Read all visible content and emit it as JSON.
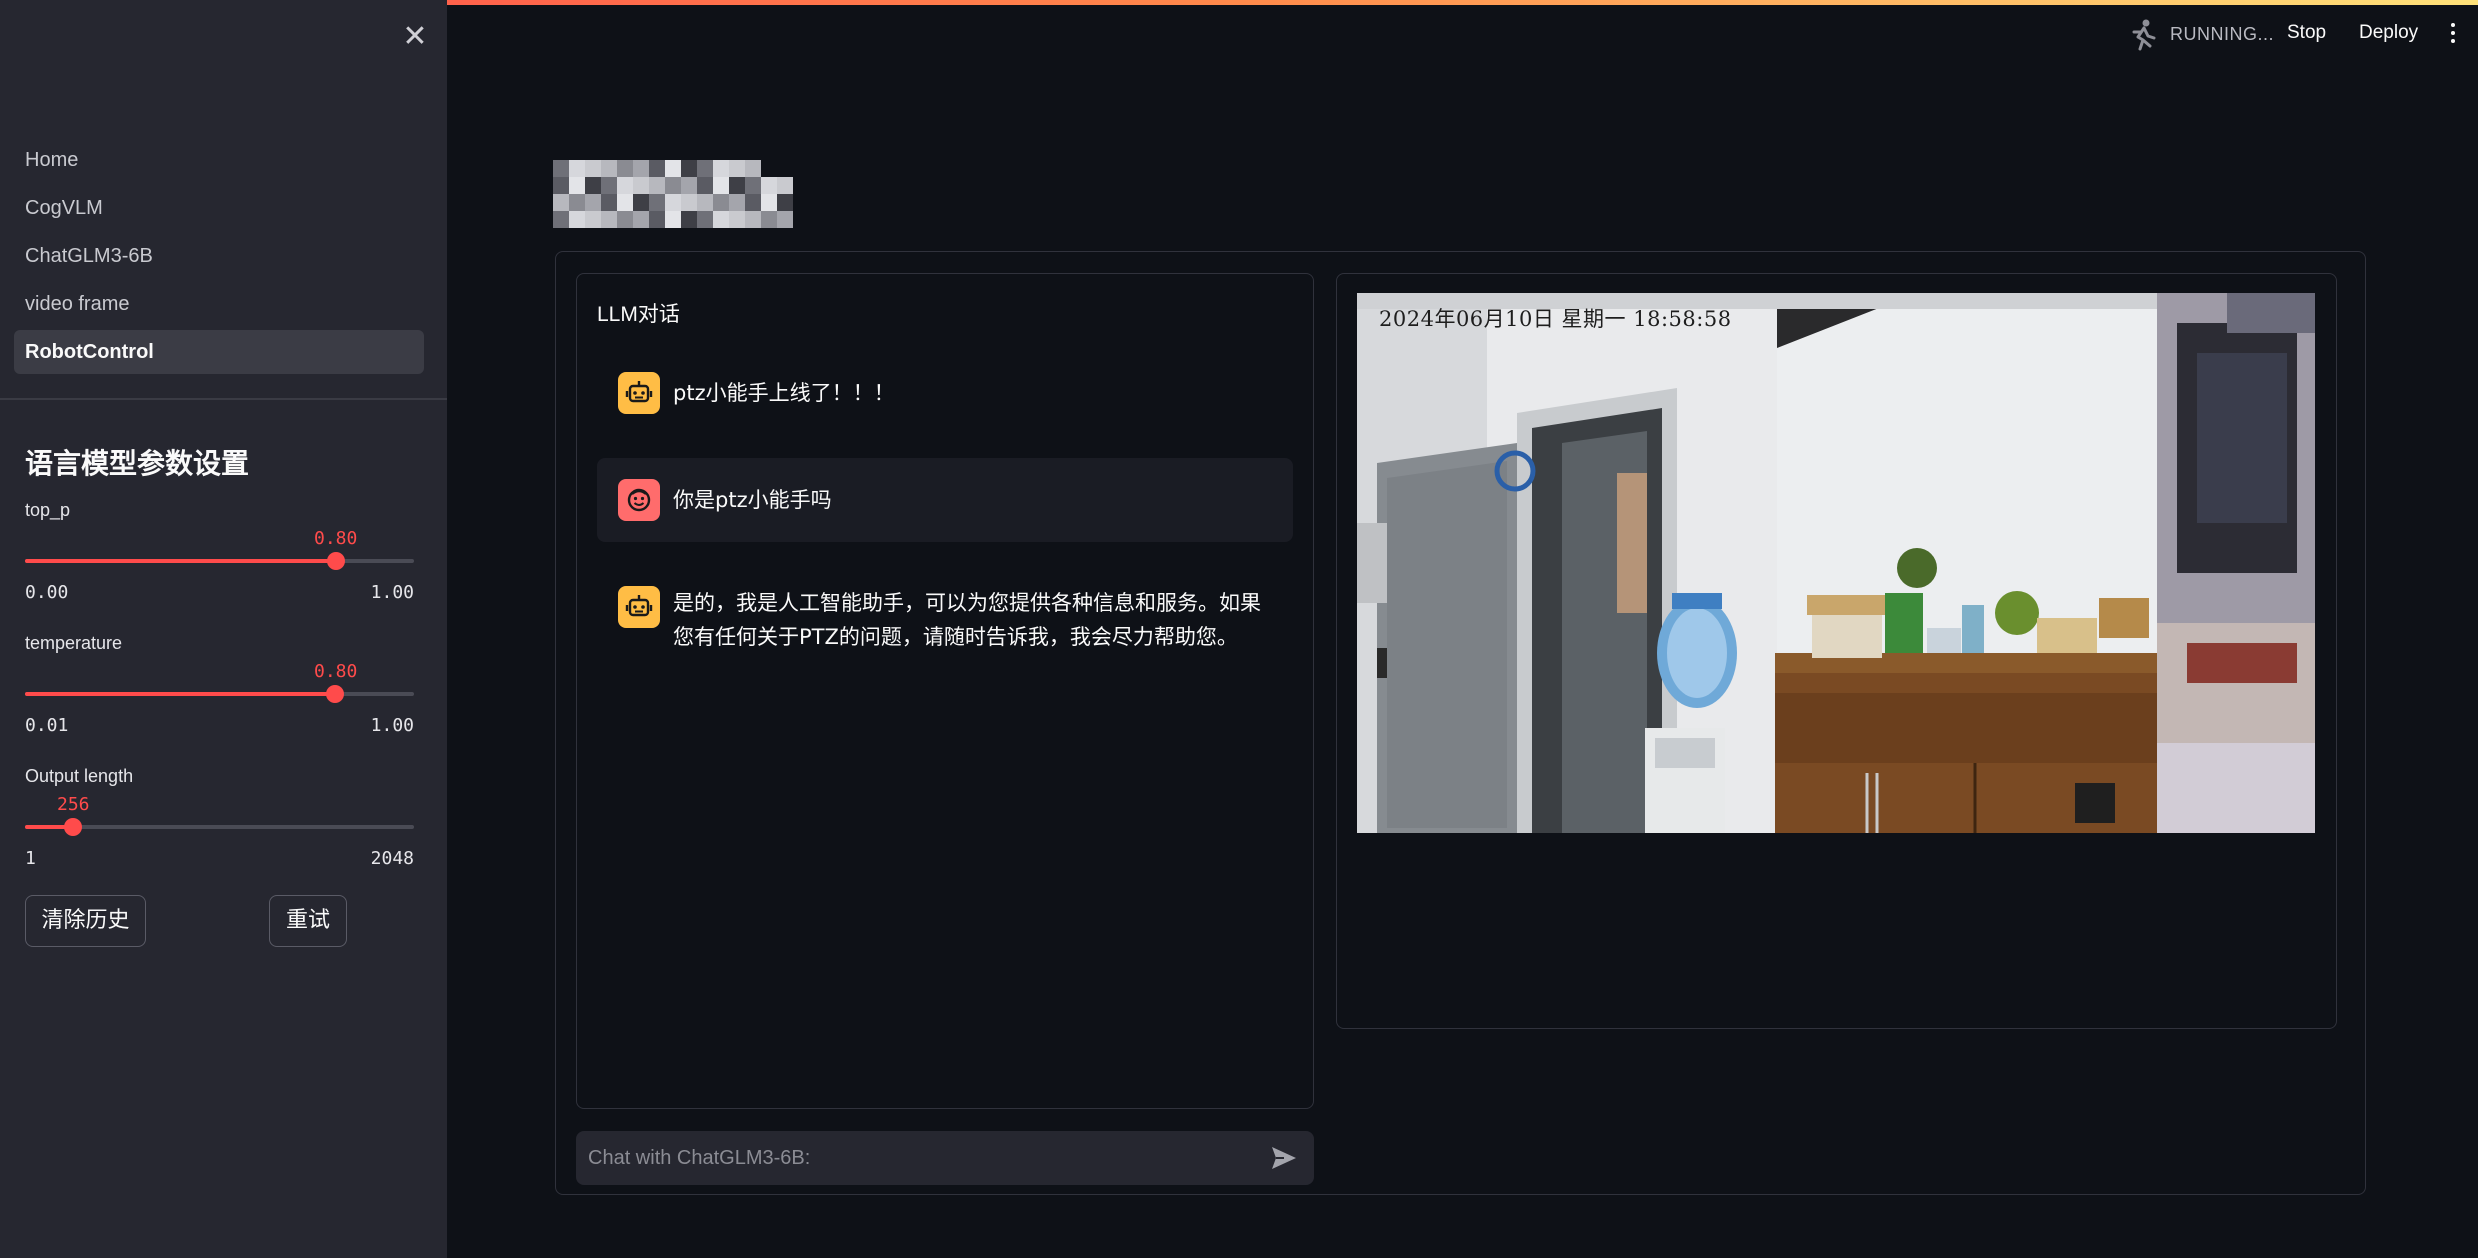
{
  "sidebar": {
    "nav": [
      {
        "label": "Home"
      },
      {
        "label": "CogVLM"
      },
      {
        "label": "ChatGLM3-6B"
      },
      {
        "label": "video frame"
      },
      {
        "label": "RobotControl",
        "active": true
      }
    ],
    "section_title": "语言模型参数设置",
    "sliders": [
      {
        "label": "top_p",
        "value": "0.80",
        "min": "0.00",
        "max": "1.00",
        "fraction": 0.8
      },
      {
        "label": "temperature",
        "value": "0.80",
        "min": "0.01",
        "max": "1.00",
        "fraction": 0.798
      },
      {
        "label": "Output length",
        "value": "256",
        "min": "1",
        "max": "2048",
        "fraction": 0.1246
      }
    ],
    "clear_button": "清除历史",
    "retry_button": "重试",
    "accent": "#ff4b4b"
  },
  "header": {
    "status": "RUNNING...",
    "stop_label": "Stop",
    "deploy_label": "Deploy",
    "status_icon": "running-person-icon",
    "menu_icon": "vertical-dots-icon"
  },
  "chat": {
    "title": "LLM对话",
    "messages": [
      {
        "role": "assistant",
        "text": "ptz小能手上线了！！！"
      },
      {
        "role": "user",
        "text": "你是ptz小能手吗"
      },
      {
        "role": "assistant",
        "text_lines": [
          "是的，我是人工智能助手，可以为您提供各种信息和服务。如果",
          "您有任何关于PTZ的问题，请随时告诉我，我会尽力帮助您。"
        ]
      }
    ],
    "input_placeholder": "Chat with ChatGLM3-6B:",
    "send_icon": "send-icon"
  },
  "video": {
    "timestamp": "2024年06月10日 星期一 18:58:58"
  }
}
